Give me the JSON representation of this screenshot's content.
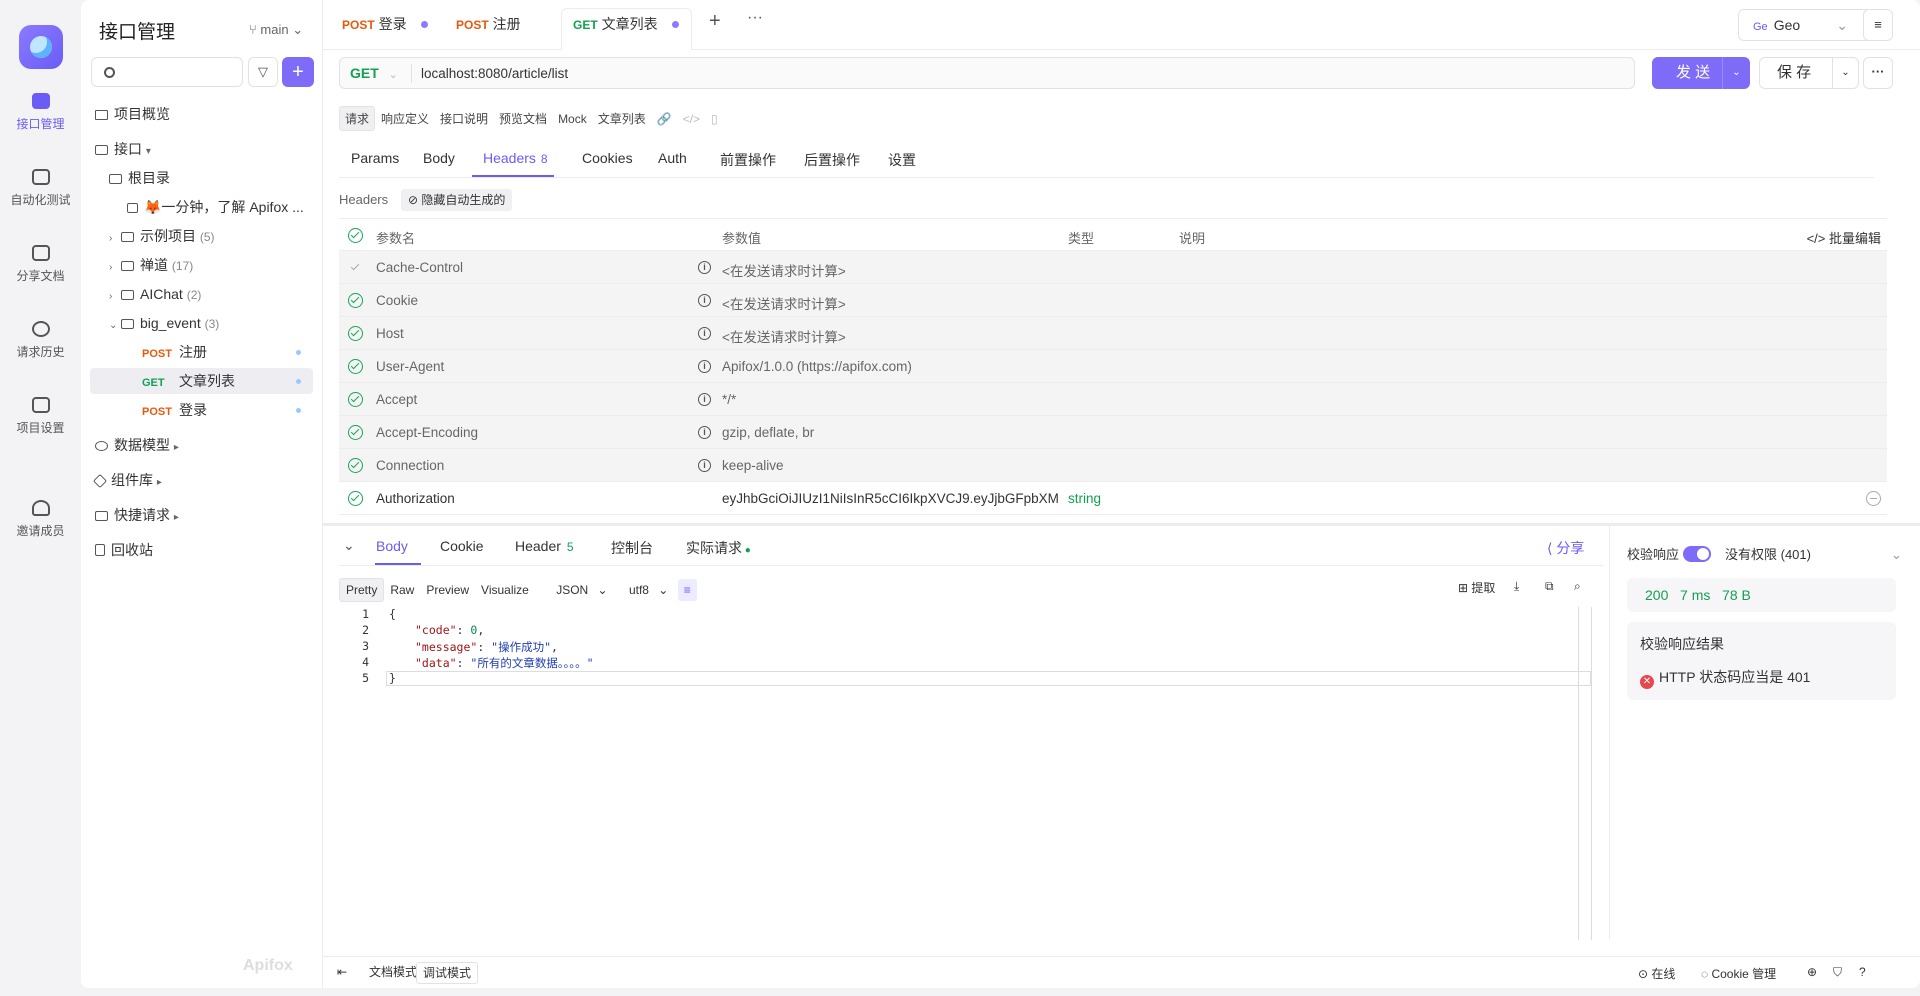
{
  "rail": {
    "items": [
      {
        "label": "接口管理",
        "icon": "api-icon",
        "active": true
      },
      {
        "label": "自动化测试",
        "icon": "stack-icon",
        "active": false
      },
      {
        "label": "分享文档",
        "icon": "doc-share-icon",
        "active": false
      },
      {
        "label": "请求历史",
        "icon": "history-icon",
        "active": false
      },
      {
        "label": "项目设置",
        "icon": "settings-icon",
        "active": false
      },
      {
        "label": "邀请成员",
        "icon": "invite-icon",
        "active": false
      }
    ]
  },
  "sidebar": {
    "title": "接口管理",
    "branch": "main",
    "nodes": [
      {
        "label": "项目概览"
      },
      {
        "label": "接口"
      },
      {
        "label": "根目录"
      },
      {
        "label": "🦊一分钟，了解 Apifox ..."
      },
      {
        "label": "示例项目",
        "count": "(5)"
      },
      {
        "label": "禅道",
        "count": "(17)"
      },
      {
        "label": "AIChat",
        "count": "(2)"
      },
      {
        "label": "big_event",
        "count": "(3)"
      },
      {
        "method": "POST",
        "label": "注册"
      },
      {
        "method": "GET",
        "label": "文章列表"
      },
      {
        "method": "POST",
        "label": "登录"
      },
      {
        "label": "数据模型"
      },
      {
        "label": "组件库"
      },
      {
        "label": "快捷请求"
      },
      {
        "label": "回收站"
      }
    ],
    "watermark": "Apifox"
  },
  "tabs": [
    {
      "method": "POST",
      "label": "登录"
    },
    {
      "method": "POST",
      "label": "注册"
    },
    {
      "method": "GET",
      "label": "文章列表"
    }
  ],
  "env": {
    "badge": "Ge",
    "label": "Geo"
  },
  "request": {
    "method": "GET",
    "url": "localhost:8080/article/list",
    "send_label": "发 送",
    "save_label": "保 存"
  },
  "subtabs": [
    "请求",
    "响应定义",
    "接口说明",
    "预览文档",
    "Mock",
    "文章列表"
  ],
  "reqtabs": [
    {
      "label": "Params"
    },
    {
      "label": "Body"
    },
    {
      "label": "Headers",
      "count": "8"
    },
    {
      "label": "Cookies"
    },
    {
      "label": "Auth"
    },
    {
      "label": "前置操作"
    },
    {
      "label": "后置操作"
    },
    {
      "label": "设置"
    }
  ],
  "headers_section": {
    "label": "Headers",
    "hide_auto": "隐藏自动生成的",
    "columns": {
      "name": "参数名",
      "value": "参数值",
      "type": "类型",
      "desc": "说明",
      "batch": "批量编辑"
    },
    "rows": [
      {
        "name": "Cache-Control",
        "value": "<在发送请求时计算>"
      },
      {
        "name": "Cookie",
        "value": "<在发送请求时计算>"
      },
      {
        "name": "Host",
        "value": "<在发送请求时计算>"
      },
      {
        "name": "User-Agent",
        "value": "Apifox/1.0.0 (https://apifox.com)"
      },
      {
        "name": "Accept",
        "value": "*/*"
      },
      {
        "name": "Accept-Encoding",
        "value": "gzip, deflate, br"
      },
      {
        "name": "Connection",
        "value": "keep-alive"
      }
    ],
    "auth_row": {
      "name": "Authorization",
      "value": "eyJhbGciOiJIUzI1NiIsInR5cCI6IkpXVCJ9.eyJjbGFpbXMiO",
      "type": "string"
    }
  },
  "response": {
    "tabs": [
      {
        "label": "Body"
      },
      {
        "label": "Cookie"
      },
      {
        "label": "Header",
        "count": "5"
      },
      {
        "label": "控制台"
      },
      {
        "label": "实际请求"
      }
    ],
    "share": "分享",
    "formats": [
      "Pretty",
      "Raw",
      "Preview",
      "Visualize"
    ],
    "lang": "JSON",
    "encoding": "utf8",
    "tools": {
      "extract": "提取"
    },
    "code_lines": [
      {
        "n": "1",
        "text": "{"
      },
      {
        "n": "2",
        "key": "\"code\"",
        "val": "0",
        "vtype": "num",
        "trail": ","
      },
      {
        "n": "3",
        "key": "\"message\"",
        "val": "\"操作成功\"",
        "vtype": "str",
        "trail": ","
      },
      {
        "n": "4",
        "key": "\"data\"",
        "val": "\"所有的文章数据。。。。\"",
        "vtype": "str",
        "trail": ""
      },
      {
        "n": "5",
        "text": "}"
      }
    ]
  },
  "validation": {
    "label": "校验响应",
    "status_label": "没有权限 (401)",
    "stats": {
      "status": "200",
      "time": "7 ms",
      "size": "78 B"
    },
    "result_title": "校验响应结果",
    "result_item": "HTTP 状态码应当是 401"
  },
  "footer": {
    "doc_mode": "文档模式",
    "debug_mode": "调试模式",
    "online": "在线",
    "cookie": "Cookie 管理"
  }
}
